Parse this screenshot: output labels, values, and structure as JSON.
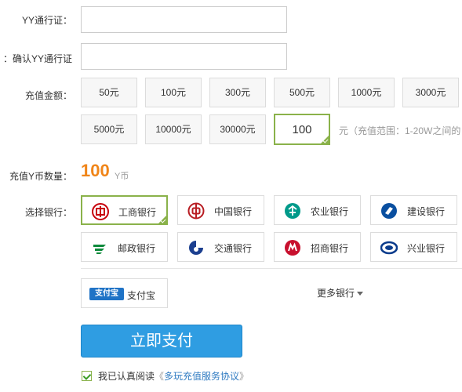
{
  "form": {
    "yy_id_label": "YY通行证：",
    "yy_id_value": "",
    "confirm_label": "确认YY通行证：",
    "confirm_value": "",
    "amount_label": "充值金额：",
    "amounts": [
      "50元",
      "100元",
      "300元",
      "500元",
      "1000元",
      "3000元",
      "5000元",
      "10000元",
      "30000元"
    ],
    "custom_amount_value": "100",
    "range_note": "元（充值范围：1-20W之间的",
    "ybi_label": "充值Y币数量：",
    "ybi_amount": "100",
    "ybi_unit": "Y币",
    "bank_label": "选择银行："
  },
  "banks": [
    {
      "name": "工商银行",
      "icon": "icbc-logo-icon",
      "color": "#c7000b",
      "selected": true
    },
    {
      "name": "中国银行",
      "icon": "boc-logo-icon",
      "color": "#b81c22",
      "selected": false
    },
    {
      "name": "农业银行",
      "icon": "abc-logo-icon",
      "color": "#009a8a",
      "selected": false
    },
    {
      "name": "建设银行",
      "icon": "ccb-logo-icon",
      "color": "#0a4fa0",
      "selected": false
    },
    {
      "name": "邮政银行",
      "icon": "psbc-logo-icon",
      "color": "#0d8a3b",
      "selected": false
    },
    {
      "name": "交通银行",
      "icon": "bocom-logo-icon",
      "color": "#1c3f8f",
      "selected": false
    },
    {
      "name": "招商银行",
      "icon": "cmb-logo-icon",
      "color": "#c8102e",
      "selected": false
    },
    {
      "name": "兴业银行",
      "icon": "cib-logo-icon",
      "color": "#0b3c8c",
      "selected": false
    }
  ],
  "alipay": {
    "logo_text": "支付宝",
    "label": "支付宝"
  },
  "more_banks": "更多银行",
  "pay_button": "立即支付",
  "agreement": {
    "text": "我已认真阅读",
    "open_quote": "《",
    "link": "多玩充值服务协议",
    "close_quote": "》"
  },
  "colors": {
    "accent_green": "#8ab24a",
    "pay_blue": "#2f9de2",
    "ybi_orange": "#f08519",
    "link_blue": "#2f7bc2"
  }
}
